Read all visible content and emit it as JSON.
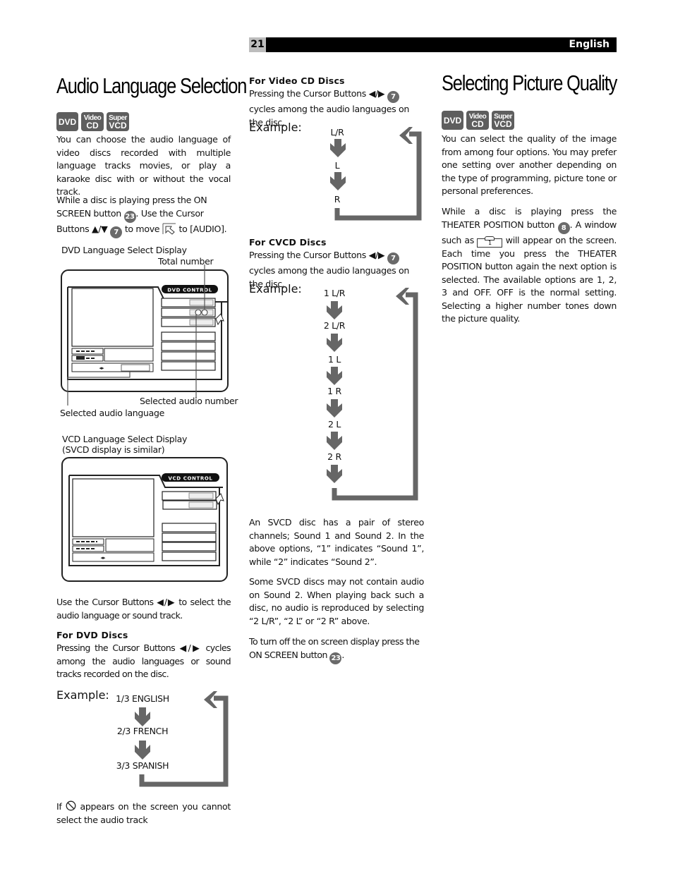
{
  "header": {
    "page_number": "21",
    "language": "English"
  },
  "badges": {
    "dvd": "DVD",
    "video_cd": [
      "Video",
      "CD"
    ],
    "super_vcd": [
      "Super",
      "VCD"
    ]
  },
  "audio_section": {
    "title": "Audio Language Selection",
    "intro": "You can choose the audio language of video discs recorded with multiple language tracks movies, or play a karaoke disc with or without the vocal track.",
    "instr_a": "While a disc is playing press the ON SCREEN button",
    "button_23": "23",
    "instr_b": ". Use the Cursor Buttons ▲/▼",
    "button_7": "7",
    "instr_c": "to move",
    "instr_d": "to [AUDIO].",
    "dvd_display": {
      "caption": "DVD Language Select Display",
      "control_label": "DVD CONTROL",
      "callout_total": "Total number",
      "callout_selected_number": "Selected audio number",
      "callout_selected_language": "Selected audio language"
    },
    "vcd_display": {
      "caption_line1": "VCD Language Select Display",
      "caption_line2": "(SVCD display is similar)",
      "control_label": "VCD CONTROL"
    },
    "use_cursor": "Use the Cursor Buttons ◀/▶ to select the audio language or sound track.",
    "dvd_discs": {
      "heading": "For DVD Discs",
      "text": "Pressing the Cursor Buttons ◀/▶ cycles among the audio languages or sound tracks recorded on the disc.",
      "example_label": "Example:",
      "cycle": [
        "1/3 ENGLISH",
        "2/3 FRENCH",
        "3/3 SPANISH"
      ]
    },
    "prohibit_a": "If",
    "prohibit_b": "appears on the screen you cannot select the audio track"
  },
  "middle": {
    "vcd_discs": {
      "heading": "For Video CD Discs",
      "text_a": "Pressing the Cursor Buttons ◀/▶",
      "button": "7",
      "text_b": "cycles among the audio languages on the disc.",
      "example_label": "Example:",
      "cycle": [
        "L/R",
        "L",
        "R"
      ]
    },
    "cvcd_discs": {
      "heading": "For CVCD Discs",
      "text_a": "Pressing the Cursor Buttons ◀/▶",
      "button": "7",
      "text_b": "cycles among the audio languages on the disc.",
      "example_label": "Example:",
      "cycle": [
        "1 L/R",
        "2 L/R",
        "1 L",
        "1 R",
        "2 L",
        "2 R"
      ]
    },
    "svcd_note": "An SVCD disc has a pair of stereo channels; Sound 1 and Sound 2.  In the above options, “1” indicates “Sound 1”, while “2” indicates “Sound 2”.",
    "svcd_note2": "Some SVCD discs may not contain audio on Sound 2.  When playing back such a disc, no audio is reproduced by selecting “2 L/R”, “2 L” or “2 R” above.",
    "turn_off_a": "To turn off the on screen display press the ON SCREEN button",
    "turn_off_button": "23",
    "turn_off_b": "."
  },
  "picture_section": {
    "title": "Selecting Picture Quality",
    "intro": "You can select the quality of the image from among four options. You may prefer one setting over another depending on the type of programming, picture tone or personal preferences.",
    "instr_a": "While a disc is playing press the THEATER POSITION button",
    "button_8": "8",
    "instr_b": ". A window such as",
    "window_value": "1",
    "instr_c": "will appear on the screen. Each time you press the THEATER POSITION button again the next option is selected. The available options are 1, 2, 3 and OFF. OFF is the normal setting. Selecting a higher number tones down the picture quality."
  },
  "colors": {
    "badge_gray": "#5e5e5e",
    "arrow_gray": "#666666",
    "header_black": "#000000",
    "page_num_gray": "#bdbdbd"
  }
}
